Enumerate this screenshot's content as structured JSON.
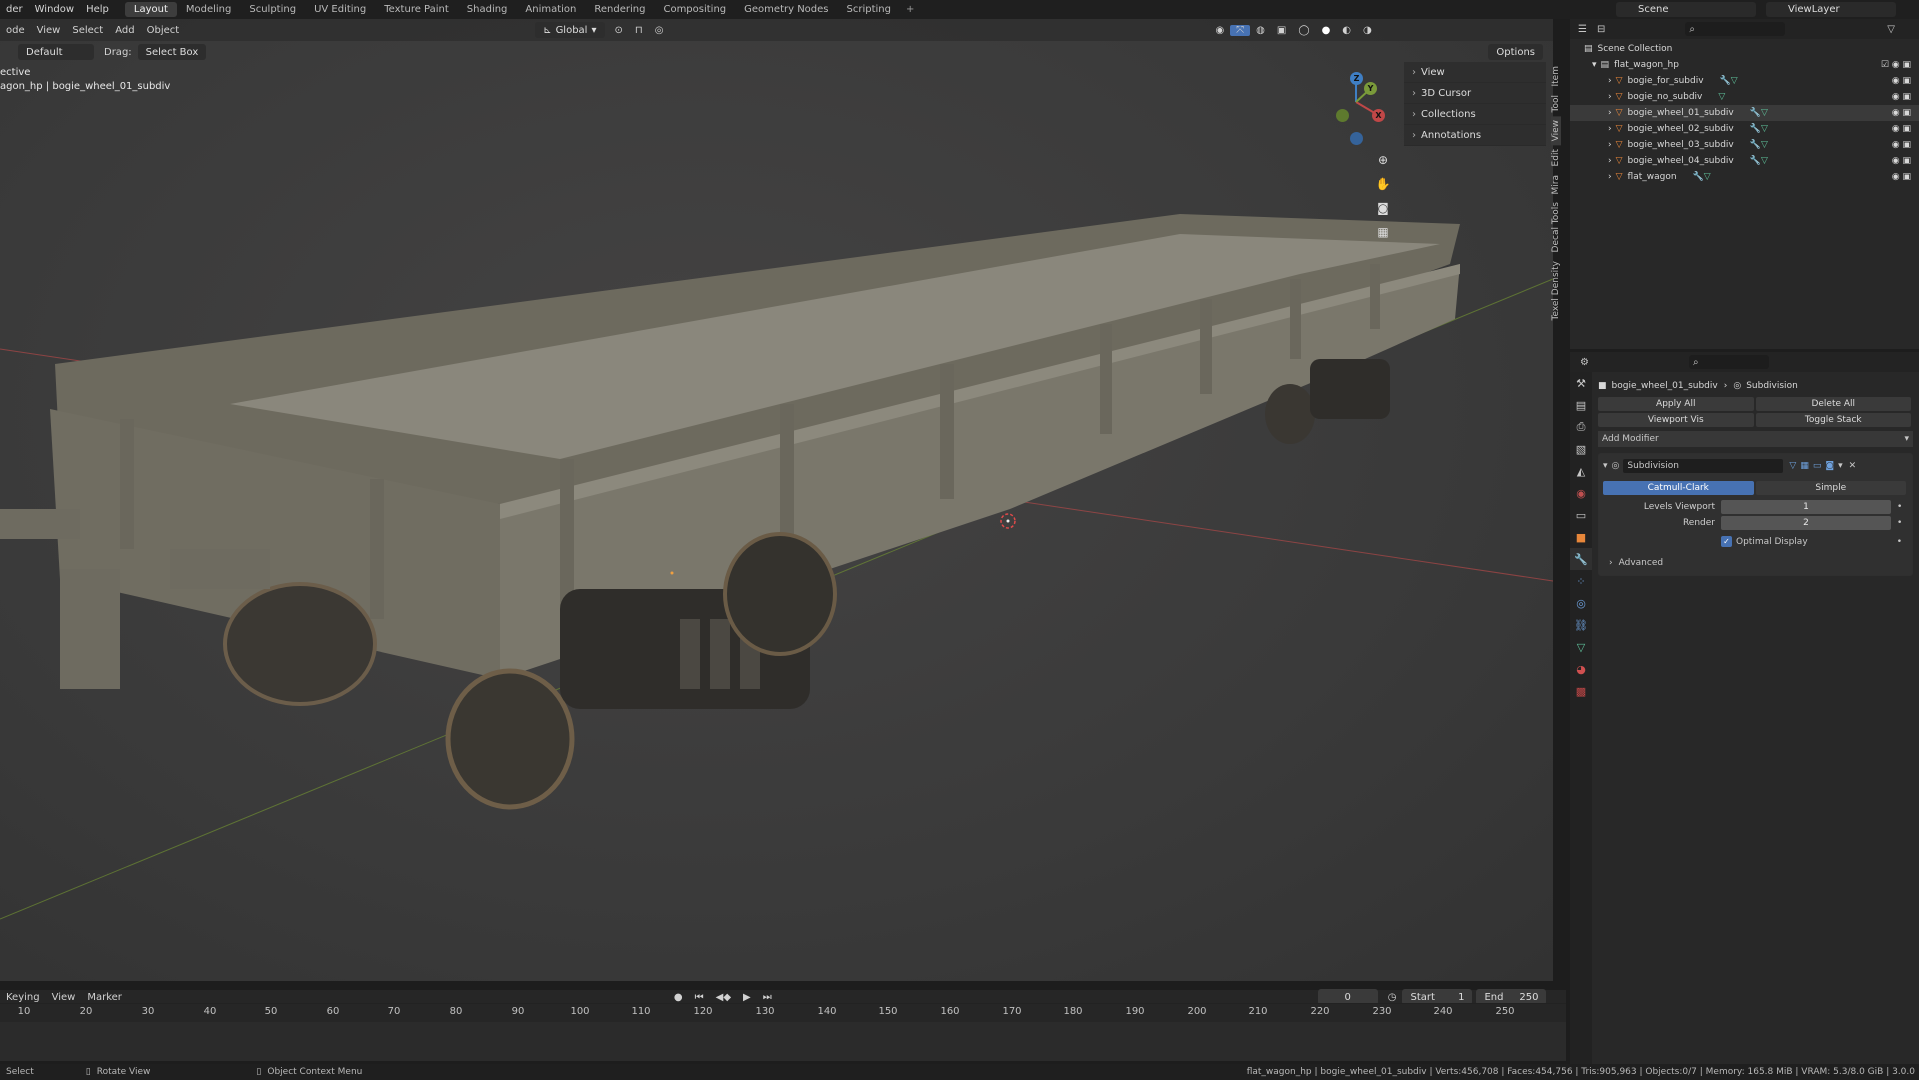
{
  "topbar": {
    "menus": [
      "der",
      "Window",
      "Help"
    ],
    "workspaces": [
      "Layout",
      "Modeling",
      "Sculpting",
      "UV Editing",
      "Texture Paint",
      "Shading",
      "Animation",
      "Rendering",
      "Compositing",
      "Geometry Nodes",
      "Scripting"
    ],
    "active_workspace": "Layout",
    "add_tab": "+",
    "scene_name": "Scene",
    "view_layer": "ViewLayer"
  },
  "viewport": {
    "header": {
      "mode": "ode",
      "menus": [
        "View",
        "Select",
        "Add",
        "Object"
      ],
      "transform_orientation": "Global",
      "options_label": "Options"
    },
    "tool_header": {
      "orientation": "Default",
      "drag_label": "Drag:",
      "drag_value": "Select Box"
    },
    "overlay": {
      "view_name": "ective",
      "object_path": "agon_hp | bogie_wheel_01_subdiv"
    },
    "sidebar_panels": [
      "View",
      "3D Cursor",
      "Collections",
      "Annotations"
    ],
    "sidebar_tabs": [
      "Item",
      "Tool",
      "View",
      "Edit",
      "Mira",
      "Decal Tools",
      "Texel Density"
    ],
    "gizmo_axes": [
      "Z",
      "Y",
      "X"
    ]
  },
  "timeline": {
    "menus": [
      "Keying",
      "View",
      "Marker"
    ],
    "current_frame": "0",
    "start_label": "Start",
    "start": "1",
    "end_label": "End",
    "end": "250",
    "ticks": [
      "10",
      "20",
      "30",
      "40",
      "50",
      "60",
      "70",
      "80",
      "90",
      "100",
      "110",
      "120",
      "130",
      "140",
      "150",
      "160",
      "170",
      "180",
      "190",
      "200",
      "210",
      "220",
      "230",
      "240",
      "250"
    ]
  },
  "statusbar": {
    "select": "Select",
    "rotate": "Rotate View",
    "context_menu": "Object Context Menu",
    "stats": "flat_wagon_hp | bogie_wheel_01_subdiv | Verts:456,708 | Faces:454,756 | Tris:905,963 | Objects:0/7 | Memory: 165.8 MiB | VRAM: 5.3/8.0 GiB | 3.0.0"
  },
  "outliner": {
    "root": "Scene Collection",
    "collection": "flat_wagon_hp",
    "objects": [
      "bogie_for_subdiv",
      "bogie_no_subdiv",
      "bogie_wheel_01_subdiv",
      "bogie_wheel_02_subdiv",
      "bogie_wheel_03_subdiv",
      "bogie_wheel_04_subdiv",
      "flat_wagon"
    ]
  },
  "properties": {
    "object_name": "bogie_wheel_01_subdiv",
    "modifier_crumb": "Subdivision",
    "apply_all": "Apply All",
    "delete_all": "Delete All",
    "viewport_vis": "Viewport Vis",
    "toggle_stack": "Toggle Stack",
    "add_modifier": "Add Modifier",
    "modifier": {
      "name": "Subdivision",
      "type_catmull": "Catmull-Clark",
      "type_simple": "Simple",
      "levels_viewport_label": "Levels Viewport",
      "levels_viewport": "1",
      "render_label": "Render",
      "render": "2",
      "optimal_display": "Optimal Display",
      "advanced": "Advanced"
    }
  },
  "colors": {
    "accent": "#4772b3",
    "x_axis": "#c04747",
    "y_axis": "#7a9a3a",
    "z_axis": "#3f7fc4"
  }
}
